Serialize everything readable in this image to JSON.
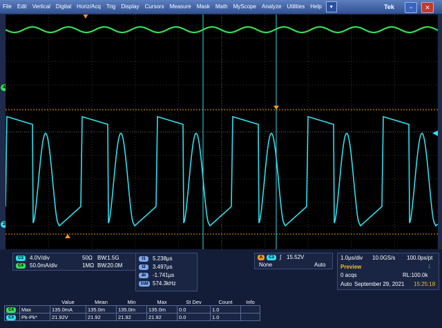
{
  "menu": {
    "items": [
      "File",
      "Edit",
      "Vertical",
      "Digital",
      "Horiz/Acq",
      "Trig",
      "Display",
      "Cursors",
      "Measure",
      "Mask",
      "Math",
      "MyScope",
      "Analyze",
      "Utilities",
      "Help"
    ],
    "dropdown": "▼",
    "brand": "Tek",
    "minimize": "−",
    "close": "✕"
  },
  "markers": {
    "ch4": "4",
    "ch2": "2"
  },
  "channels": {
    "ch3": {
      "label": "C3",
      "scale": "4.0V/div",
      "imp": "50Ω",
      "bw_label": "BW",
      "bw": ":1.5G"
    },
    "ch4": {
      "label": "C4",
      "scale": "50.0mA/div",
      "imp": "1MΩ",
      "bw_label": "BW",
      "bw": ":20.0M"
    }
  },
  "cursors": {
    "t1_label": "t1",
    "t1": "5.238µs",
    "t2_label": "t2",
    "t2": "3.497µs",
    "dt_label": "Δt",
    "dt": "-1.741µs",
    "inv_label": "1/Δt",
    "inv": "574.3kHz"
  },
  "trigger": {
    "a_label": "A",
    "ch_label": "C3",
    "slope": "∫",
    "level": "15.52V",
    "type": "None",
    "mode": "Auto"
  },
  "acq": {
    "horiz": "1.0µs/div",
    "rate": "10.0GS/s",
    "res": "100.0ps/pt",
    "state": "Preview",
    "acqs": "0 acqs",
    "rl": "RL:100.0k",
    "mode": "Auto",
    "date": "September 29, 2021",
    "time": "15:25:18"
  },
  "measurements": {
    "headers": [
      "",
      "",
      "Value",
      "Mean",
      "Min",
      "Max",
      "St Dev",
      "Count",
      "Info"
    ],
    "rows": [
      {
        "badge": "C4",
        "name": "Max",
        "values": [
          "135.0mA",
          "135.0m",
          "135.0m",
          "135.0m",
          "0.0",
          "1.0",
          ""
        ]
      },
      {
        "badge": "C3",
        "name": "Pk-Pk*",
        "values": [
          "21.92V",
          "21.92",
          "21.92",
          "21.92",
          "0.0",
          "1.0",
          ""
        ]
      }
    ]
  },
  "colors": {
    "ch3": "#2fe0f0",
    "ch4": "#35e050",
    "cursor": "#f09a20",
    "grid": "#3a3a3a"
  }
}
